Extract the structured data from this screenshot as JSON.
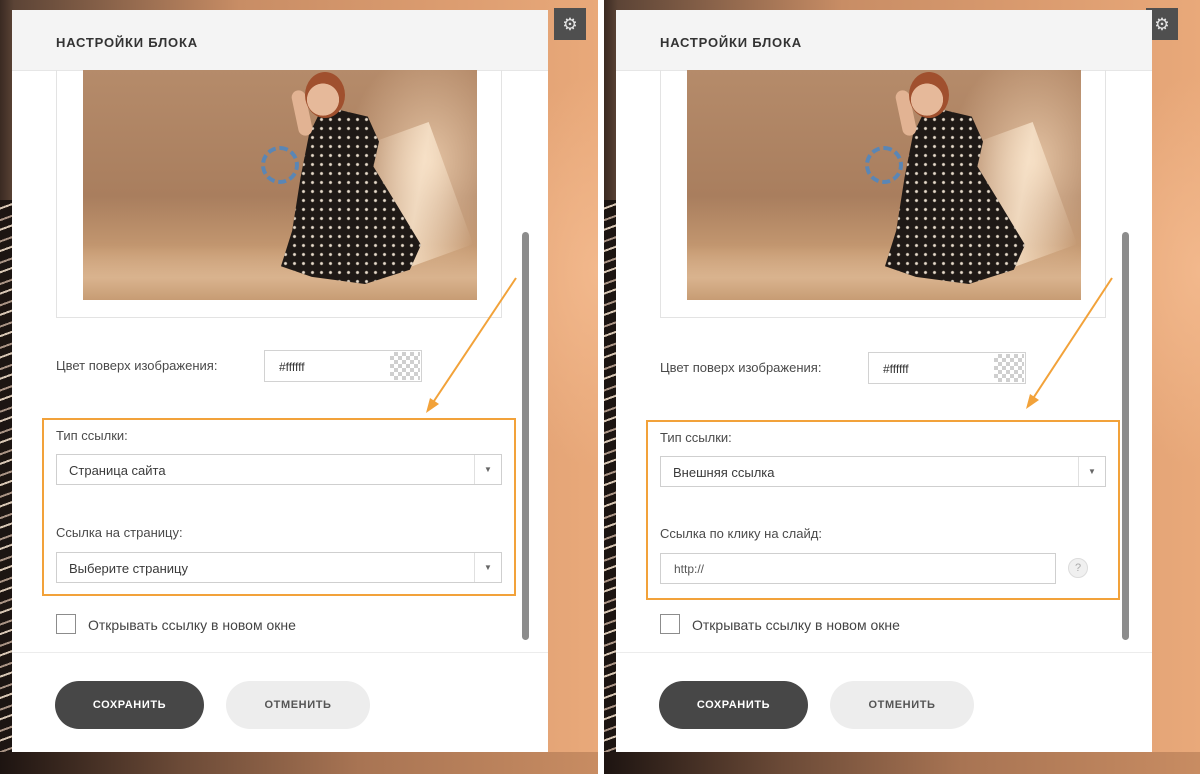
{
  "colors": {
    "accent_highlight": "#f2a23a",
    "primary_button": "#474747",
    "secondary_button": "#ededed",
    "spinner": "#5a86b5"
  },
  "icons": {
    "settings": "gear-icon",
    "dropdown": "caret-down-icon",
    "help": "question-icon",
    "loading": "spinner-icon"
  },
  "screens": {
    "left": {
      "gear_glyph": "⚙",
      "panel_title": "НАСТРОЙКИ БЛОКА",
      "overlay_color_label": "Цвет поверх изображения:",
      "overlay_color_value": "#ffffff",
      "link_type_label": "Тип ссылки:",
      "link_type_value": "Страница сайта",
      "page_link_label": "Ссылка на страницу:",
      "page_link_value": "Выберите страницу",
      "open_new_window_label": "Открывать ссылку в новом окне",
      "save_label": "СОХРАНИТЬ",
      "cancel_label": "ОТМЕНИТЬ"
    },
    "right": {
      "gear_glyph": "⚙",
      "panel_title": "НАСТРОЙКИ БЛОКА",
      "overlay_color_label": "Цвет поверх изображения:",
      "overlay_color_value": "#ffffff",
      "link_type_label": "Тип ссылки:",
      "link_type_value": "Внешняя ссылка",
      "slide_link_label": "Ссылка по клику на слайд:",
      "slide_link_value": "http://",
      "help_glyph": "?",
      "open_new_window_label": "Открывать ссылку в новом окне",
      "save_label": "СОХРАНИТЬ",
      "cancel_label": "ОТМЕНИТЬ"
    }
  }
}
